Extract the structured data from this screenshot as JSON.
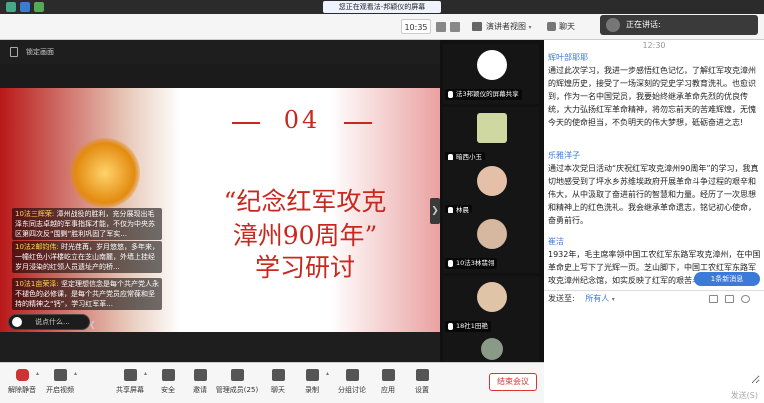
{
  "window": {
    "share_banner": "您正在观看法-邦颖仪的屏幕"
  },
  "toolbar": {
    "time": "10:35",
    "layout_label": "演讲者视图",
    "chat_tab": "聊天",
    "speaking_label": "正在讲话:"
  },
  "screen": {
    "lock_label": "锁定画面",
    "expand_glyph": "❯"
  },
  "slide": {
    "number": "04",
    "title_line1": "“纪念红军攻克",
    "title_line2": "漳州90周年”",
    "title_line3": "学习研讨"
  },
  "danmaku": [
    {
      "name": "10法三辉荣:",
      "text": "漳州战役的胜利，充分展现出毛泽东同志卓越的军事指挥才能，不仅为中央苏区第四次反“围剿”胜利巩固了军实..."
    },
    {
      "name": "10法2邮钧伟:",
      "text": "时光荏苒，岁月悠悠，多年来，一幢红色小洋楼屹立在芝山南麓，外墙上挂经岁月浸染的红领人员遗址产的桥..."
    },
    {
      "name": "10法1亩荣泽:",
      "text": "坚定理想信念是每个共产党人永不褪色的必修课，是每个共产党员应常葆和坚持的精神之“钙”，学习红军革..."
    }
  ],
  "comment": {
    "placeholder": "说点什么...",
    "collapse": "❮"
  },
  "videos": [
    {
      "label": "法3邦颖仪的屏幕共享"
    },
    {
      "label": "暗西小玉"
    },
    {
      "label": "林晨"
    },
    {
      "label": "10法3林翡翎"
    },
    {
      "label": "18社1田艳"
    },
    {
      "label": ""
    }
  ],
  "chat": {
    "time": "12:30",
    "messages": [
      {
        "name": "辉叶部耶耶",
        "text": "通过此次学习，我进一步感悟红色记忆，了解红军攻克漳州的辉煌历史，接受了一场深刻的党史学习教育洗礼。也愈识到，作为一名中国党员，我要始终继承革命先烈的优良传统，大力弘扬红军革命精神，将勿忘前天的苦难辉煌，无愧今天的使命担当，不负明天的伟大梦想，砥砺奋进之志!"
      },
      {
        "name": "乐雅洋子",
        "text": "通过本次党日活动“庆祝红军攻克漳州90周年”的学习，我真切地感受到了坪水乡苏维埃政府开展革命斗争过程的艰辛和伟大，从中汲取了奋进前行的智慧和力量。经历了一次思想和精神上的红色洗礼。我会继承革命遗志，铭记初心使命，奋勇前行。"
      },
      {
        "name": "崔洁",
        "text": "1932年，毛主席率领中国工农红军东路军攻克漳州，在中国革命史上写下了光辉一页。芝山脚下，中国工农红军东路军攻克漳州纪念馆，如实反映了红军的艰苦斗争和..."
      }
    ],
    "new_msg": "1条新消息",
    "send_to_label": "发送至:",
    "send_to_value": "所有人",
    "input_placeholder": "",
    "send_btn": "发送(S)"
  },
  "bottom": {
    "items": [
      "解除静音",
      "开启视频",
      "共享屏幕",
      "安全",
      "邀请",
      "管理成员(25)",
      "聊天",
      "录制",
      "分组讨论",
      "应用",
      "设置"
    ],
    "end": "结束会议"
  }
}
